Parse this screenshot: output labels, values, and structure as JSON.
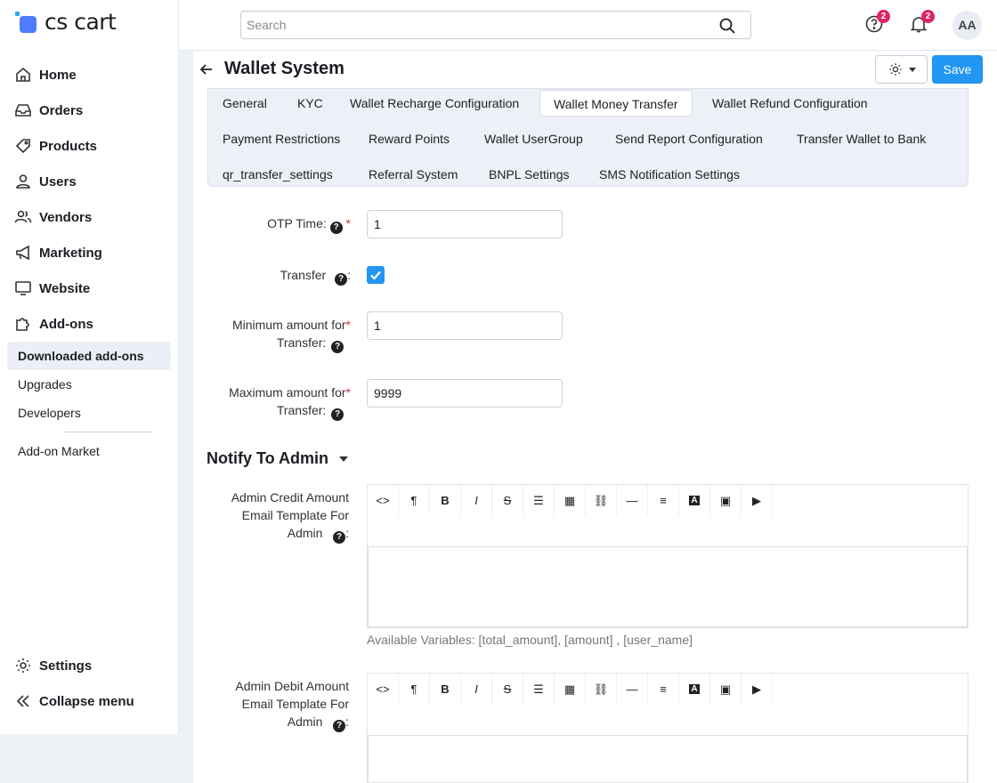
{
  "app": {
    "logo_text": "cs cart"
  },
  "header": {
    "search_placeholder": "Search",
    "help_badge": "2",
    "notif_badge": "2",
    "avatar_initials": "AA"
  },
  "sidebar": {
    "items": [
      {
        "label": "Home",
        "icon": "home-icon"
      },
      {
        "label": "Orders",
        "icon": "inbox-icon"
      },
      {
        "label": "Products",
        "icon": "tag-icon"
      },
      {
        "label": "Users",
        "icon": "user-icon"
      },
      {
        "label": "Vendors",
        "icon": "users-icon"
      },
      {
        "label": "Marketing",
        "icon": "megaphone-icon"
      },
      {
        "label": "Website",
        "icon": "monitor-icon"
      },
      {
        "label": "Add-ons",
        "icon": "puzzle-icon"
      }
    ],
    "subitems": [
      "Downloaded add-ons",
      "Upgrades",
      "Developers",
      "Add-on Market"
    ],
    "settings": "Settings",
    "collapse": "Collapse menu"
  },
  "page": {
    "title": "Wallet System",
    "save": "Save"
  },
  "tabs": [
    "General",
    "KYC",
    "Wallet Recharge Configuration",
    "Wallet Money Transfer",
    "Wallet Refund Configuration",
    "Payment Restrictions",
    "Reward Points",
    "Wallet UserGroup",
    "Send Report Configuration",
    "Transfer Wallet to Bank",
    "qr_transfer_settings",
    "Referral System",
    "BNPL Settings",
    "SMS Notification Settings"
  ],
  "active_tab": "Wallet Money Transfer",
  "form": {
    "otp_label": "OTP Time:",
    "otp_value": "1",
    "transfer_label": "Transfer",
    "transfer_checked": true,
    "min_label_1": "Minimum amount for",
    "min_label_2": "Transfer:",
    "min_value": "1",
    "max_label_1": "Maximum amount for",
    "max_label_2": "Transfer:",
    "max_value": "9999"
  },
  "notify": {
    "section_title": "Notify To Admin",
    "credit_label_1": "Admin Credit Amount",
    "credit_label_2": "Email Template For",
    "credit_label_3": "Admin",
    "variables_hint": "Available Variables: [total_amount], [amount] , [user_name]",
    "debit_label_1": "Admin Debit Amount",
    "debit_label_2": "Email Template For",
    "debit_label_3": "Admin"
  },
  "colors": {
    "accent": "#2196f3",
    "badge": "#e0245e",
    "required": "#d9363e"
  }
}
